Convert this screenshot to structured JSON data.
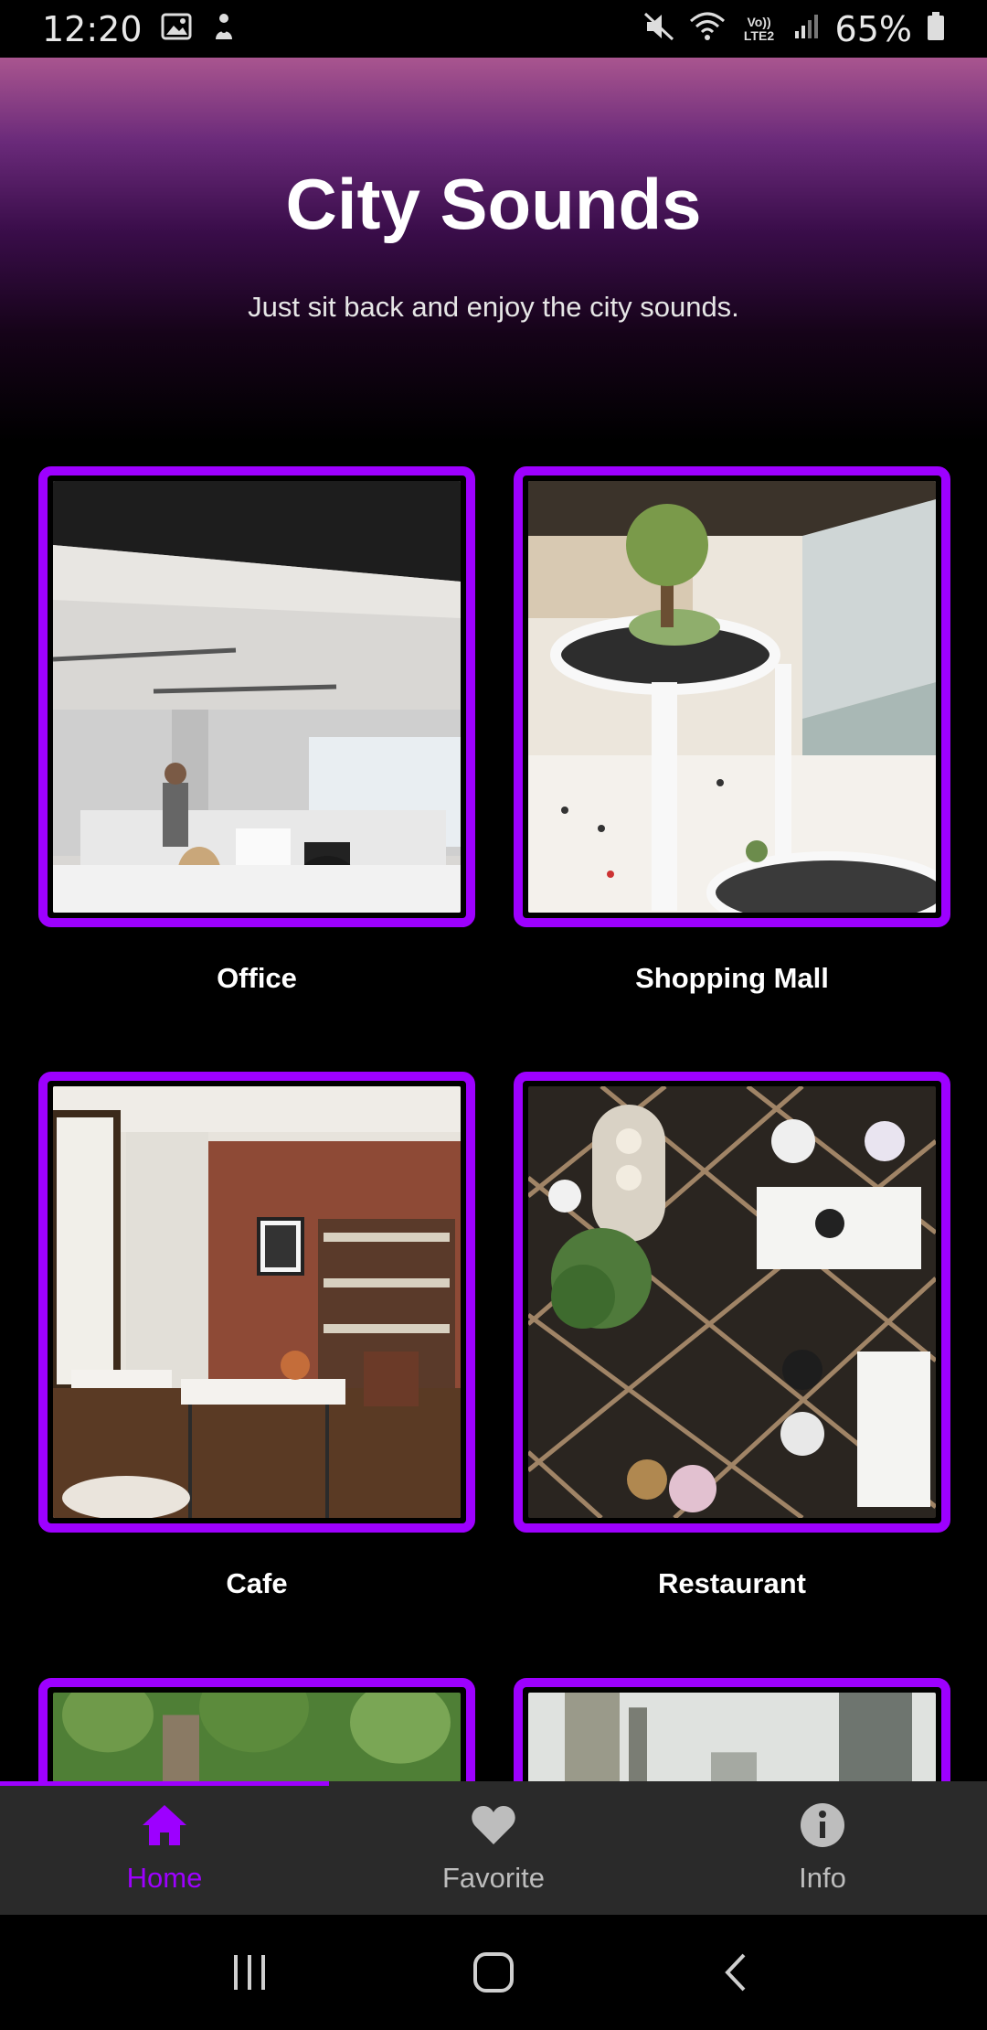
{
  "status_bar": {
    "time": "12:20",
    "battery_text": "65%",
    "network_label": "Vo)) LTE2"
  },
  "header": {
    "title": "City Sounds",
    "subtitle": "Just sit back and enjoy the city sounds."
  },
  "cards": [
    {
      "label": "Office"
    },
    {
      "label": "Shopping Mall"
    },
    {
      "label": "Cafe"
    },
    {
      "label": "Restaurant"
    },
    {
      "label": ""
    },
    {
      "label": ""
    }
  ],
  "bottom_nav": {
    "items": [
      {
        "label": "Home",
        "icon": "home-icon",
        "active": true
      },
      {
        "label": "Favorite",
        "icon": "heart-icon",
        "active": false
      },
      {
        "label": "Info",
        "icon": "info-icon",
        "active": false
      }
    ]
  },
  "colors": {
    "accent": "#9d00ff",
    "nav_background": "#2a2a2a",
    "page_background": "#000000"
  }
}
